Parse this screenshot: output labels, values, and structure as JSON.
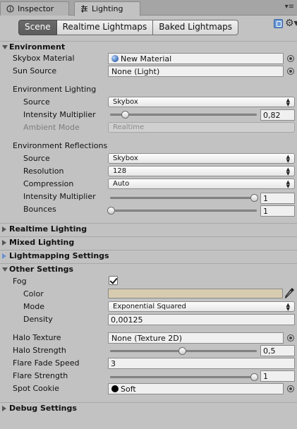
{
  "tabs": [
    {
      "label": "Inspector",
      "icon": "info-icon"
    },
    {
      "label": "Lighting",
      "icon": "lighting-sliders-icon"
    }
  ],
  "window_menu": "▾≡",
  "mode_tabs": {
    "items": [
      "Scene",
      "Realtime Lightmaps",
      "Baked Lightmaps"
    ],
    "selected": "Scene"
  },
  "environment": {
    "header": "Environment",
    "skybox_material_label": "Skybox Material",
    "skybox_material_value": "New Material",
    "sun_source_label": "Sun Source",
    "sun_source_value": "None (Light)",
    "lighting_header": "Environment Lighting",
    "lighting_source_label": "Source",
    "lighting_source_value": "Skybox",
    "lighting_intensity_label": "Intensity Multiplier",
    "lighting_intensity_value": "0,82",
    "lighting_intensity_fraction": 0.1,
    "ambient_mode_label": "Ambient Mode",
    "ambient_mode_value": "Realtime",
    "reflections_header": "Environment Reflections",
    "reflections_source_label": "Source",
    "reflections_source_value": "Skybox",
    "resolution_label": "Resolution",
    "resolution_value": "128",
    "compression_label": "Compression",
    "compression_value": "Auto",
    "reflections_intensity_label": "Intensity Multiplier",
    "reflections_intensity_value": "1",
    "reflections_intensity_fraction": 1.0,
    "bounces_label": "Bounces",
    "bounces_value": "1",
    "bounces_fraction": 0.0
  },
  "sections": {
    "realtime": "Realtime Lighting",
    "mixed": "Mixed Lighting",
    "lightmapping": "Lightmapping Settings",
    "other": "Other Settings",
    "debug": "Debug Settings"
  },
  "other": {
    "fog_label": "Fog",
    "fog_checked": true,
    "color_label": "Color",
    "fog_color": "#d8ccb0",
    "mode_label": "Mode",
    "mode_value": "Exponential Squared",
    "density_label": "Density",
    "density_value": "0,00125",
    "halo_texture_label": "Halo Texture",
    "halo_texture_value": "None (Texture 2D)",
    "halo_strength_label": "Halo Strength",
    "halo_strength_value": "0,5",
    "halo_strength_fraction": 0.5,
    "flare_fade_label": "Flare Fade Speed",
    "flare_fade_value": "3",
    "flare_strength_label": "Flare Strength",
    "flare_strength_value": "1",
    "flare_strength_fraction": 1.0,
    "spot_cookie_label": "Spot Cookie",
    "spot_cookie_value": "Soft"
  },
  "colors": {
    "selected_tab": "#5e5e5e",
    "panel_bg": "#c2c2c2",
    "lightmapping_arrow": "#6d8fd0"
  }
}
